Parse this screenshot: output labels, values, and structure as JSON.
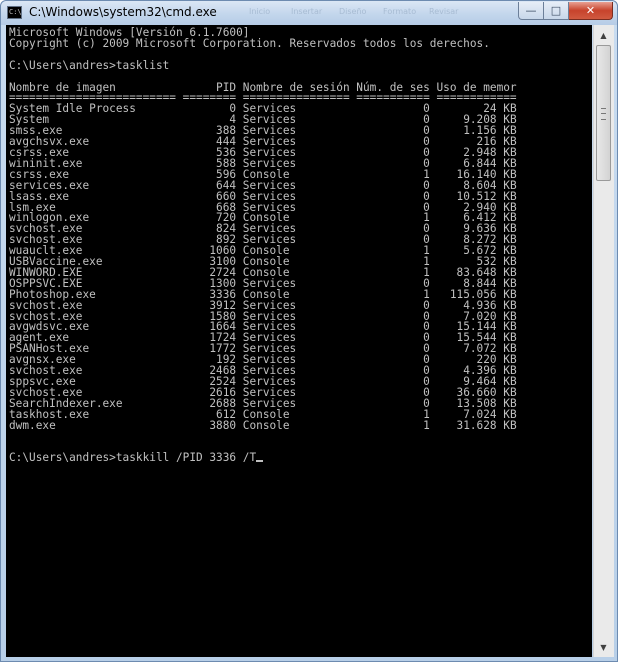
{
  "window": {
    "title": "C:\\Windows\\system32\\cmd.exe",
    "ghost_menu": [
      "Inicio",
      "Insertar",
      "Diseño",
      "Formato",
      "Revisar"
    ],
    "minimize_glyph": "—",
    "maximize_glyph": "□",
    "close_glyph": "✕"
  },
  "console": {
    "header_lines": [
      "Microsoft Windows [Versión 6.1.7600]",
      "Copyright (c) 2009 Microsoft Corporation. Reservados todos los derechos."
    ],
    "prompt": "C:\\Users\\andres>",
    "first_command": "tasklist",
    "table_header": "Nombre de imagen               PID Nombre de sesión Núm. de ses Uso de memor",
    "table_separator": "========================= ======== ================ =========== ============",
    "processes": [
      {
        "name": "System Idle Process",
        "pid": "0",
        "session": "Services",
        "session_num": "0",
        "memory": "24 KB"
      },
      {
        "name": "System",
        "pid": "4",
        "session": "Services",
        "session_num": "0",
        "memory": "9.208 KB"
      },
      {
        "name": "smss.exe",
        "pid": "388",
        "session": "Services",
        "session_num": "0",
        "memory": "1.156 KB"
      },
      {
        "name": "avgchsvx.exe",
        "pid": "444",
        "session": "Services",
        "session_num": "0",
        "memory": "216 KB"
      },
      {
        "name": "csrss.exe",
        "pid": "536",
        "session": "Services",
        "session_num": "0",
        "memory": "2.948 KB"
      },
      {
        "name": "wininit.exe",
        "pid": "588",
        "session": "Services",
        "session_num": "0",
        "memory": "6.844 KB"
      },
      {
        "name": "csrss.exe",
        "pid": "596",
        "session": "Console",
        "session_num": "1",
        "memory": "16.140 KB"
      },
      {
        "name": "services.exe",
        "pid": "644",
        "session": "Services",
        "session_num": "0",
        "memory": "8.604 KB"
      },
      {
        "name": "lsass.exe",
        "pid": "660",
        "session": "Services",
        "session_num": "0",
        "memory": "10.512 KB"
      },
      {
        "name": "lsm.exe",
        "pid": "668",
        "session": "Services",
        "session_num": "0",
        "memory": "2.940 KB"
      },
      {
        "name": "winlogon.exe",
        "pid": "720",
        "session": "Console",
        "session_num": "1",
        "memory": "6.412 KB"
      },
      {
        "name": "svchost.exe",
        "pid": "824",
        "session": "Services",
        "session_num": "0",
        "memory": "9.636 KB"
      },
      {
        "name": "svchost.exe",
        "pid": "892",
        "session": "Services",
        "session_num": "0",
        "memory": "8.272 KB"
      },
      {
        "name": "wuauclt.exe",
        "pid": "1060",
        "session": "Console",
        "session_num": "1",
        "memory": "5.672 KB"
      },
      {
        "name": "USBVaccine.exe",
        "pid": "3100",
        "session": "Console",
        "session_num": "1",
        "memory": "532 KB"
      },
      {
        "name": "WINWORD.EXE",
        "pid": "2724",
        "session": "Console",
        "session_num": "1",
        "memory": "83.648 KB"
      },
      {
        "name": "OSPPSVC.EXE",
        "pid": "1300",
        "session": "Services",
        "session_num": "0",
        "memory": "8.844 KB"
      },
      {
        "name": "Photoshop.exe",
        "pid": "3336",
        "session": "Console",
        "session_num": "1",
        "memory": "115.056 KB"
      },
      {
        "name": "svchost.exe",
        "pid": "3912",
        "session": "Services",
        "session_num": "0",
        "memory": "4.936 KB"
      },
      {
        "name": "svchost.exe",
        "pid": "1580",
        "session": "Services",
        "session_num": "0",
        "memory": "7.020 KB"
      },
      {
        "name": "avgwdsvc.exe",
        "pid": "1664",
        "session": "Services",
        "session_num": "0",
        "memory": "15.144 KB"
      },
      {
        "name": "agent.exe",
        "pid": "1724",
        "session": "Services",
        "session_num": "0",
        "memory": "15.544 KB"
      },
      {
        "name": "PSANHost.exe",
        "pid": "1772",
        "session": "Services",
        "session_num": "0",
        "memory": "7.072 KB"
      },
      {
        "name": "avgnsx.exe",
        "pid": "192",
        "session": "Services",
        "session_num": "0",
        "memory": "220 KB"
      },
      {
        "name": "svchost.exe",
        "pid": "2468",
        "session": "Services",
        "session_num": "0",
        "memory": "4.396 KB"
      },
      {
        "name": "sppsvc.exe",
        "pid": "2524",
        "session": "Services",
        "session_num": "0",
        "memory": "9.464 KB"
      },
      {
        "name": "svchost.exe",
        "pid": "2616",
        "session": "Services",
        "session_num": "0",
        "memory": "36.660 KB"
      },
      {
        "name": "SearchIndexer.exe",
        "pid": "2688",
        "session": "Services",
        "session_num": "0",
        "memory": "13.508 KB"
      },
      {
        "name": "taskhost.exe",
        "pid": "612",
        "session": "Console",
        "session_num": "1",
        "memory": "7.024 KB"
      },
      {
        "name": "dwm.exe",
        "pid": "3880",
        "session": "Console",
        "session_num": "1",
        "memory": "31.628 KB"
      }
    ],
    "current_command": "taskkill /PID 3336 /T"
  },
  "icons": {
    "window_icon": "cmd-icon",
    "scroll_up": "scroll-up-arrow-icon",
    "scroll_down": "scroll-down-arrow-icon"
  },
  "colors": {
    "console_bg": "#000000",
    "console_fg": "#c0c0c0",
    "close_button": "#c7432c"
  }
}
